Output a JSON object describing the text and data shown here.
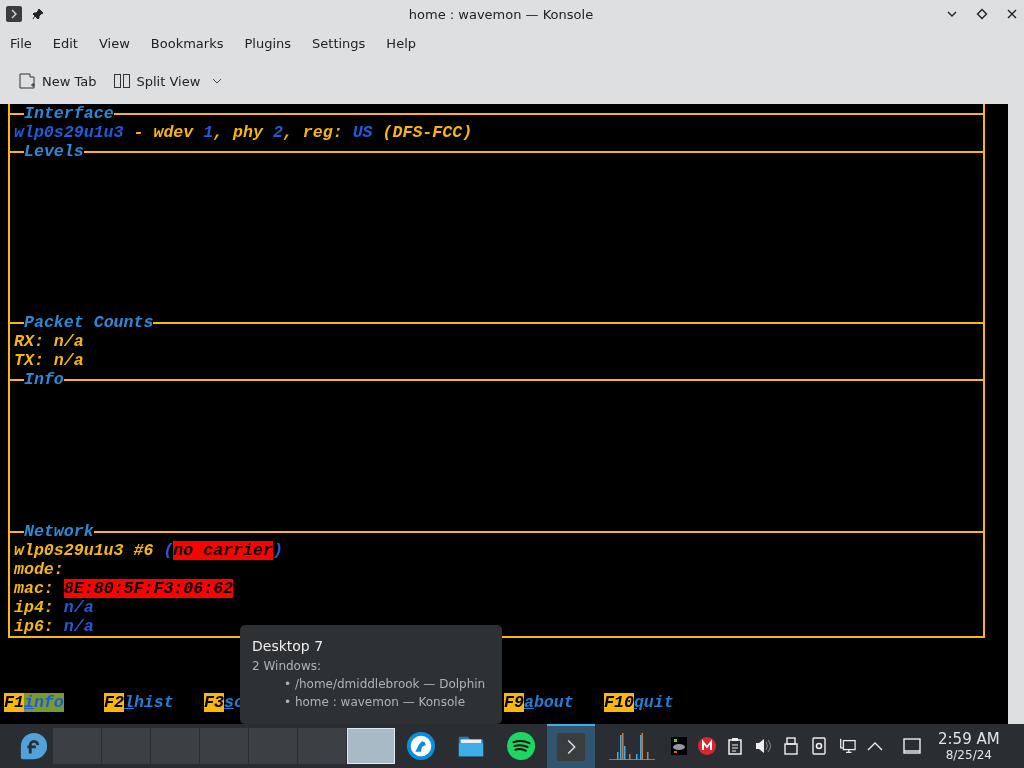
{
  "window": {
    "title": "home : wavemon — Konsole"
  },
  "menu": [
    "File",
    "Edit",
    "View",
    "Bookmarks",
    "Plugins",
    "Settings",
    "Help"
  ],
  "toolbar": [
    {
      "label": "New Tab",
      "kind": "newtab"
    },
    {
      "label": "Split View",
      "kind": "split"
    }
  ],
  "terminal": {
    "sections": [
      {
        "heading": "Interface",
        "lines": [
          [
            {
              "text": "wlp0s29u1u3",
              "kind": "value"
            },
            {
              "text": " - wdev ",
              "kind": "label"
            },
            {
              "text": "1",
              "kind": "value"
            },
            {
              "text": ", phy ",
              "kind": "label"
            },
            {
              "text": "2",
              "kind": "value"
            },
            {
              "text": ", reg: ",
              "kind": "label"
            },
            {
              "text": "US",
              "kind": "value"
            },
            {
              "text": " (DFS-FCC)",
              "kind": "label"
            }
          ]
        ]
      },
      {
        "heading": "Levels"
      },
      {
        "heading": "Packet Counts",
        "lines": [
          [
            {
              "text": "RX: n/a",
              "kind": "label"
            }
          ],
          [
            {
              "text": "TX: n/a",
              "kind": "label"
            }
          ]
        ]
      },
      {
        "heading": "Info"
      },
      {
        "heading": "Network",
        "lines": [
          [
            {
              "text": "wlp0s29u1u3 #6 ",
              "kind": "label"
            },
            {
              "text": "(",
              "kind": "value"
            },
            {
              "text": "no carrier",
              "kind": "alert"
            },
            {
              "text": ")",
              "kind": "value"
            }
          ],
          [
            {
              "text": "mode:",
              "kind": "label"
            }
          ],
          [
            {
              "text": "mac: ",
              "kind": "label"
            },
            {
              "text": "8E:80:5F:F3:06:62",
              "kind": "alert"
            }
          ],
          [
            {
              "text": "ip4: ",
              "kind": "label"
            },
            {
              "text": "n/a",
              "kind": "value"
            }
          ],
          [
            {
              "text": "ip6: ",
              "kind": "label"
            },
            {
              "text": "n/a",
              "kind": "value"
            }
          ]
        ]
      }
    ],
    "function_keys": [
      {
        "key": "F1",
        "label": "info",
        "selected": true
      },
      {
        "key": "F2",
        "label": "lhist",
        "selected": false
      },
      {
        "key": "F3",
        "label": "sc",
        "selected": false
      },
      {
        "key": "F9",
        "label": "about",
        "selected": false
      },
      {
        "key": "F10",
        "label": "quit",
        "selected": false
      }
    ]
  },
  "tooltip": {
    "title": "Desktop 7",
    "subtitle": "2 Windows:",
    "items": [
      "• /home/dmiddlebrook — Dolphin",
      "• home : wavemon — Konsole"
    ]
  },
  "taskbar": {
    "pager": [
      {
        "selected": false
      },
      {
        "selected": false
      },
      {
        "selected": false
      },
      {
        "selected": false
      },
      {
        "selected": false
      },
      {
        "selected": false
      },
      {
        "selected": true
      }
    ],
    "tasks": [
      {
        "kind": "browser",
        "active": false
      },
      {
        "kind": "folder",
        "active": false
      },
      {
        "kind": "music",
        "active": false
      },
      {
        "kind": "terminal",
        "active": true
      }
    ],
    "clock": {
      "time": "2:59 AM",
      "date": "8/25/24"
    }
  }
}
